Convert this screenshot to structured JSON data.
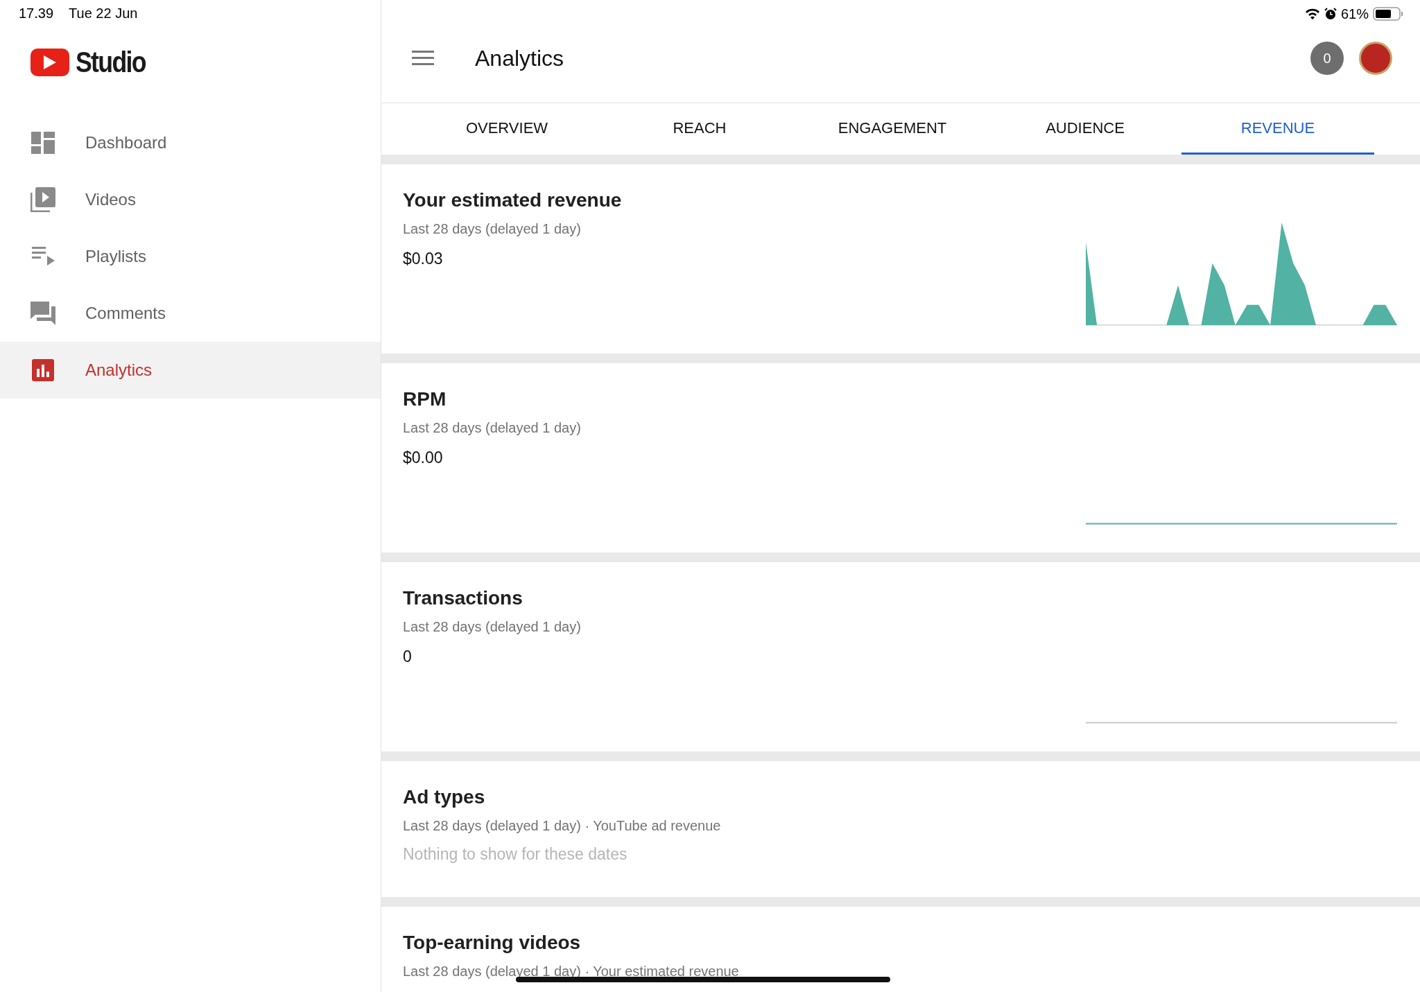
{
  "status_bar": {
    "time": "17.39",
    "date": "Tue 22 Jun",
    "battery": "61%"
  },
  "sidebar": {
    "logo_text": "Studio",
    "items": [
      {
        "label": "Dashboard",
        "selected": false
      },
      {
        "label": "Videos",
        "selected": false
      },
      {
        "label": "Playlists",
        "selected": false
      },
      {
        "label": "Comments",
        "selected": false
      },
      {
        "label": "Analytics",
        "selected": true
      }
    ]
  },
  "header": {
    "title": "Analytics",
    "notification_count": "0"
  },
  "tabs": [
    {
      "label": "OVERVIEW",
      "selected": false
    },
    {
      "label": "REACH",
      "selected": false
    },
    {
      "label": "ENGAGEMENT",
      "selected": false
    },
    {
      "label": "AUDIENCE",
      "selected": false
    },
    {
      "label": "REVENUE",
      "selected": true
    }
  ],
  "cards": [
    {
      "kind": "metric",
      "title": "Your estimated revenue",
      "subtitle": "Last 28 days (delayed 1 day)",
      "value": "$0.03",
      "sparkline": {
        "kind": "area"
      }
    },
    {
      "kind": "metric",
      "title": "RPM",
      "subtitle": "Last 28 days (delayed 1 day)",
      "value": "$0.00",
      "sparkline": {
        "kind": "line"
      }
    },
    {
      "kind": "metric",
      "title": "Transactions",
      "subtitle": "Last 28 days (delayed 1 day)",
      "value": "0",
      "sparkline": {
        "kind": "baseline"
      }
    },
    {
      "kind": "empty",
      "title": "Ad types",
      "subtitle": "Last 28 days (delayed 1 day) · YouTube ad revenue",
      "message": "Nothing to show for these dates"
    },
    {
      "kind": "list",
      "title": "Top-earning videos",
      "subtitle": "Last 28 days (delayed 1 day) · Your estimated revenue"
    }
  ]
}
